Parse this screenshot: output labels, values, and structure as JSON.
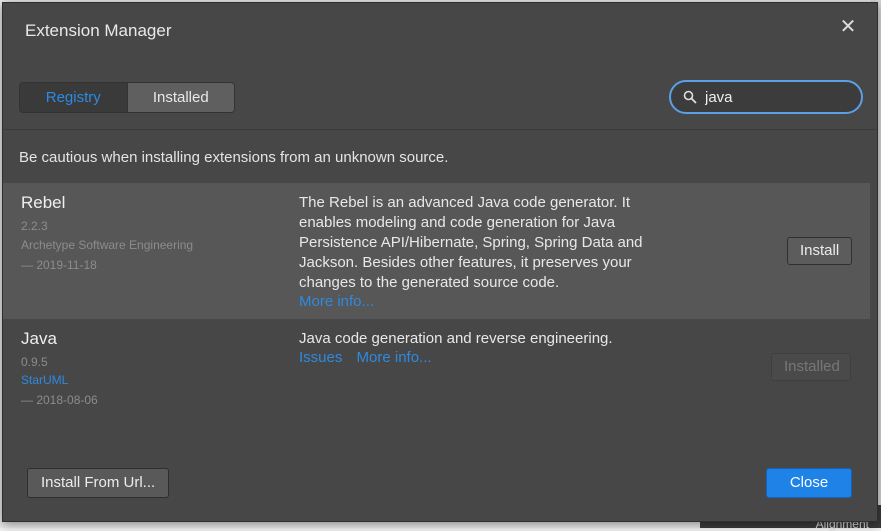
{
  "dialog": {
    "title": "Extension Manager",
    "close_icon": "close-icon"
  },
  "tabs": [
    {
      "label": "Registry",
      "active": true
    },
    {
      "label": "Installed",
      "active": false
    }
  ],
  "search": {
    "icon": "search-icon",
    "value": "java"
  },
  "warning": "Be cautious when installing extensions from an unknown source.",
  "extensions": [
    {
      "name": "Rebel",
      "version": "2.2.3",
      "author": "Archetype Software Engineering",
      "date": "— 2019-11-18",
      "description": "The Rebel is an advanced Java code generator. It enables modeling and code generation for Java Persistence API/Hibernate, Spring, Spring Data and Jackson. Besides other features, it preserves your changes to the generated source code.",
      "links": [
        "More info..."
      ],
      "action": "Install"
    },
    {
      "name": "Java",
      "version": "0.9.5",
      "author": "StarUML",
      "date": "— 2018-08-06",
      "description": "Java code generation and reverse engineering.",
      "links": [
        "Issues",
        "More info..."
      ],
      "action": "Installed"
    }
  ],
  "footer": {
    "install_url": "Install From Url...",
    "close": "Close"
  },
  "background": {
    "bottom_label": "Alignment"
  },
  "colors": {
    "accent": "#1e82e6",
    "link": "#2e8ae0",
    "dialog_bg": "#474747",
    "row_highlight": "#575757"
  }
}
